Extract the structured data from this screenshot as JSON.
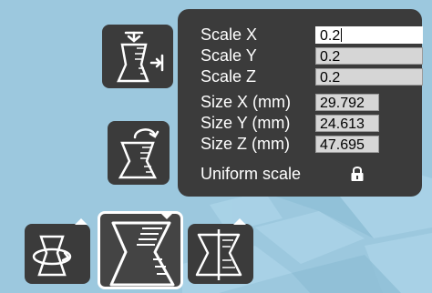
{
  "scale_panel": {
    "rows": [
      {
        "label": "Scale X",
        "value": "0.2",
        "editing": true
      },
      {
        "label": "Scale Y",
        "value": "0.2"
      },
      {
        "label": "Scale Z",
        "value": "0.2"
      },
      {
        "label": "Size X (mm)",
        "value": "29.792"
      },
      {
        "label": "Size Y (mm)",
        "value": "24.613"
      },
      {
        "label": "Size Z (mm)",
        "value": "47.695"
      }
    ],
    "uniform_label": "Uniform scale",
    "uniform_locked": true
  },
  "tools": {
    "lay_flat": {
      "icon": "lay-flat-icon"
    },
    "reset": {
      "icon": "reset-scale-icon"
    },
    "rotate": {
      "icon": "rotate-icon"
    },
    "scale": {
      "icon": "scale-icon",
      "active": true
    },
    "mirror": {
      "icon": "mirror-icon"
    }
  },
  "colors": {
    "panel_bg": "#3b3b3b",
    "viewport_bg": "#9cc8de",
    "field_bg": "#d6d6d6",
    "text": "#ffffff"
  }
}
